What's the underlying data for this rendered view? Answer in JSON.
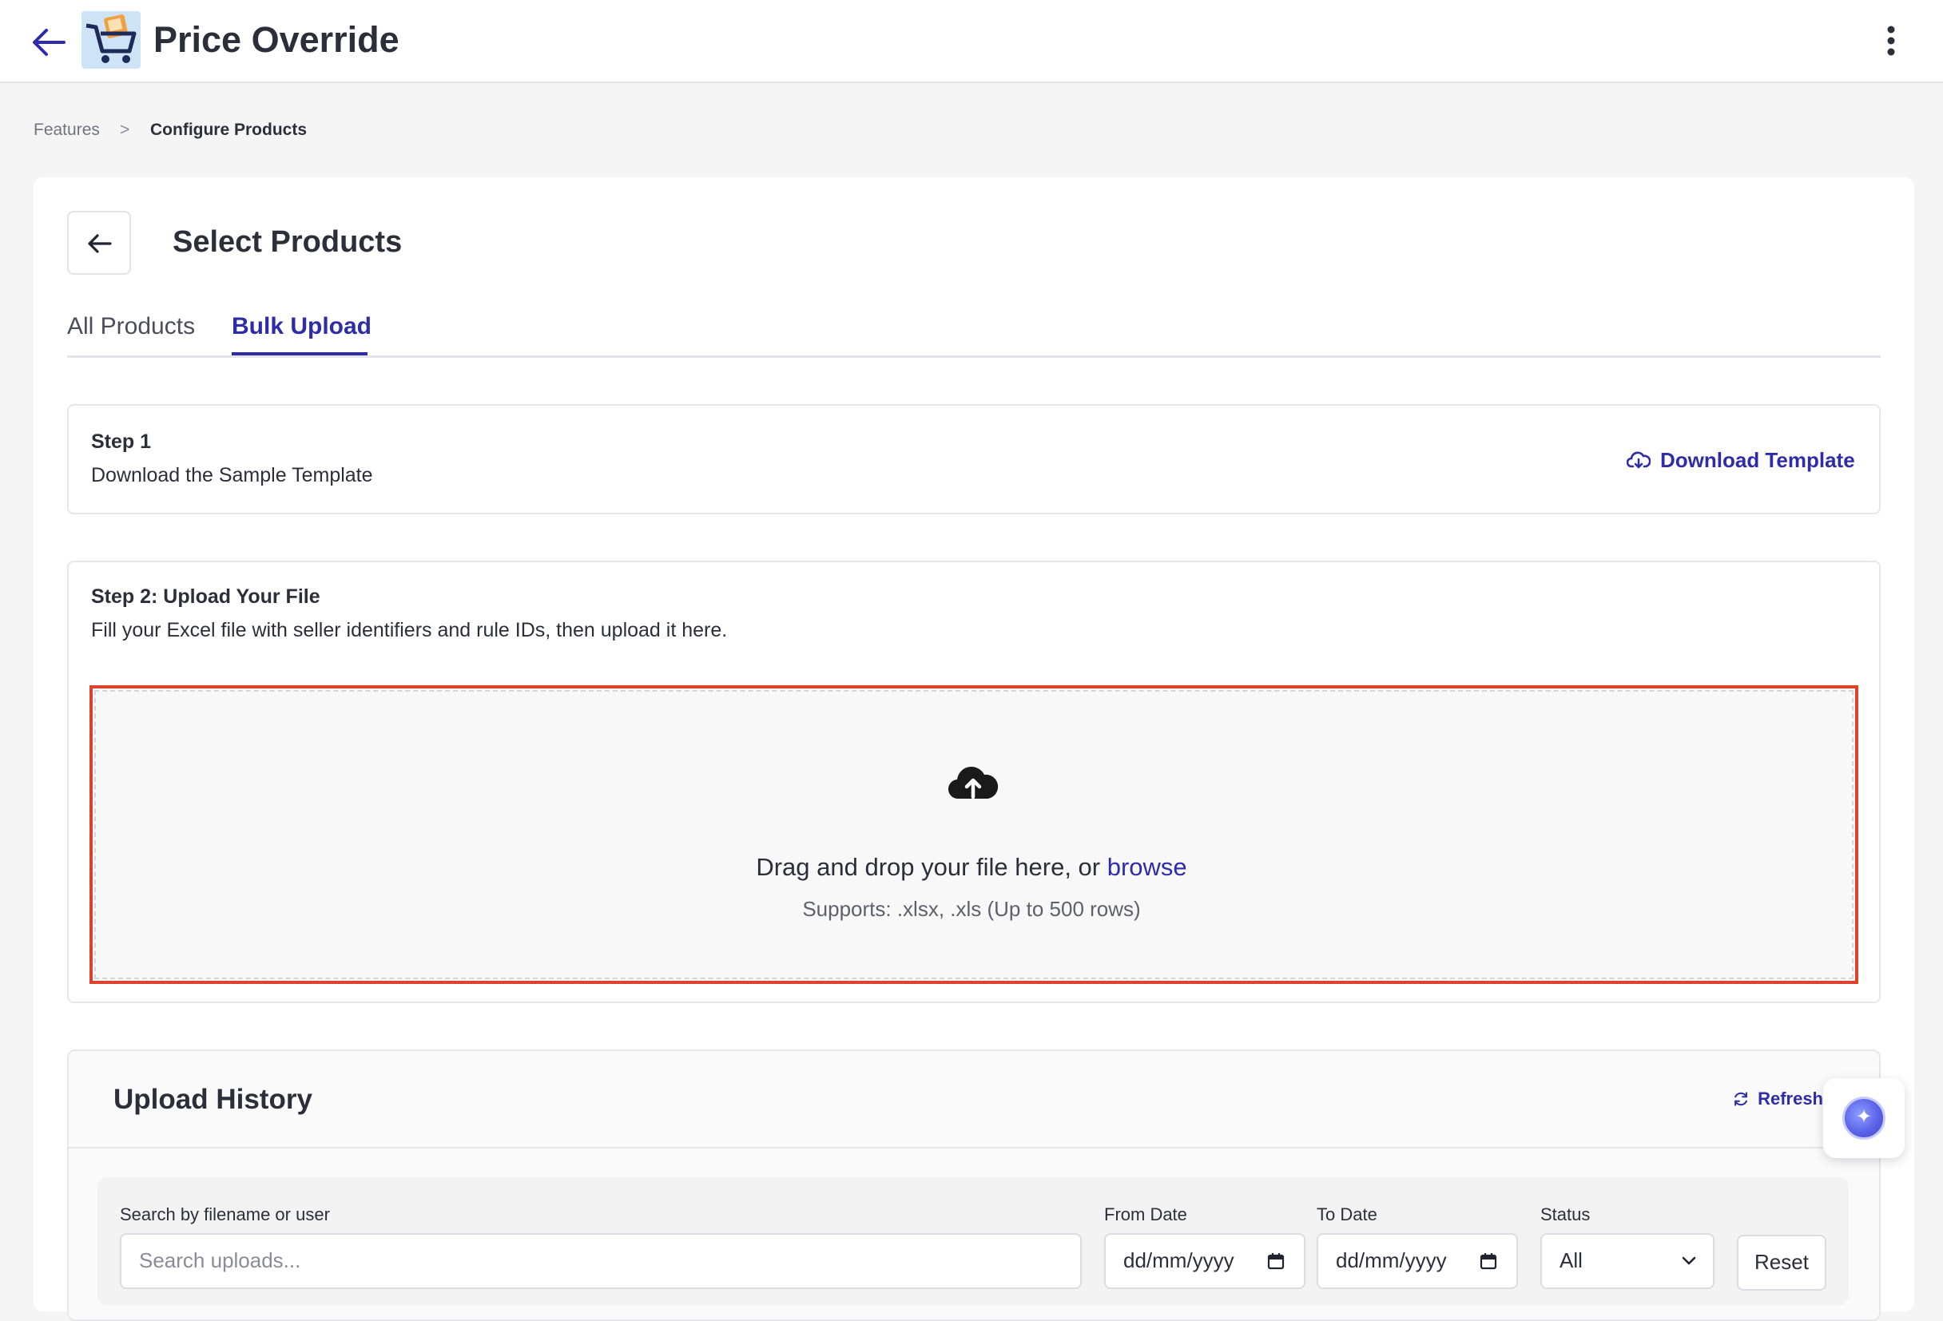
{
  "header": {
    "title": "Price Override",
    "back_icon": "arrow-left-icon",
    "menu_icon": "kebab-menu-icon"
  },
  "breadcrumb": {
    "items": [
      "Features",
      "Configure Products"
    ],
    "separator": ">"
  },
  "page": {
    "title": "Select Products"
  },
  "tabs": [
    {
      "label": "All Products",
      "active": false
    },
    {
      "label": "Bulk Upload",
      "active": true
    }
  ],
  "step1": {
    "label": "Step 1",
    "description": "Download the Sample Template",
    "action_label": "Download Template"
  },
  "step2": {
    "label": "Step 2: Upload Your File",
    "description": "Fill your Excel file with seller identifiers and rule IDs, then upload it here.",
    "dropzone": {
      "text": "Drag and drop your file here, or",
      "browse_label": "browse",
      "supports": "Supports: .xlsx, .xls (Up to 500 rows)"
    }
  },
  "history": {
    "title": "Upload History",
    "refresh_label": "Refresh",
    "filters": {
      "search_label": "Search by filename or user",
      "search_placeholder": "Search uploads...",
      "from_label": "From Date",
      "from_value": "dd/mm/yyyy",
      "to_label": "To Date",
      "to_value": "dd/mm/yyyy",
      "status_label": "Status",
      "status_value": "All",
      "reset_label": "Reset"
    }
  },
  "colors": {
    "accent": "#2e2cab",
    "highlight_border": "#e0412a",
    "page_bg": "#f5f5f6"
  }
}
